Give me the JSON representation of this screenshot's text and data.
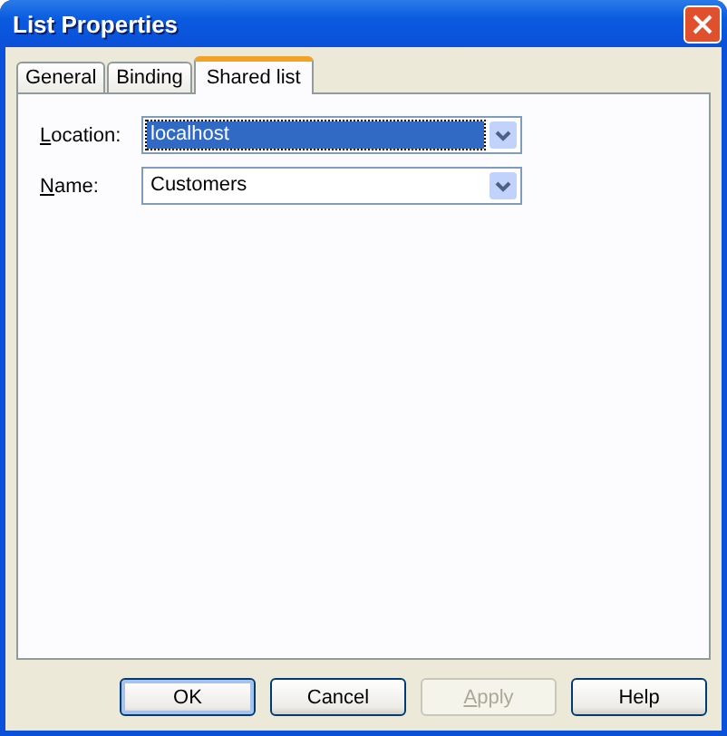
{
  "window": {
    "title": "List Properties"
  },
  "tabs": [
    {
      "label": "General",
      "selected": false
    },
    {
      "label": "Binding",
      "selected": false
    },
    {
      "label": "Shared list",
      "selected": true
    }
  ],
  "fields": [
    {
      "access_key": "L",
      "label_rest": "ocation:",
      "value": "localhost",
      "selected": true
    },
    {
      "access_key": "N",
      "label_rest": "ame:",
      "value": "Customers",
      "selected": false
    }
  ],
  "buttons": [
    {
      "label": "OK",
      "default": true,
      "disabled": false
    },
    {
      "label": "Cancel",
      "default": false,
      "disabled": false
    },
    {
      "access_key": "A",
      "label_rest": "pply",
      "default": false,
      "disabled": true
    },
    {
      "label": "Help",
      "default": false,
      "disabled": false
    }
  ]
}
